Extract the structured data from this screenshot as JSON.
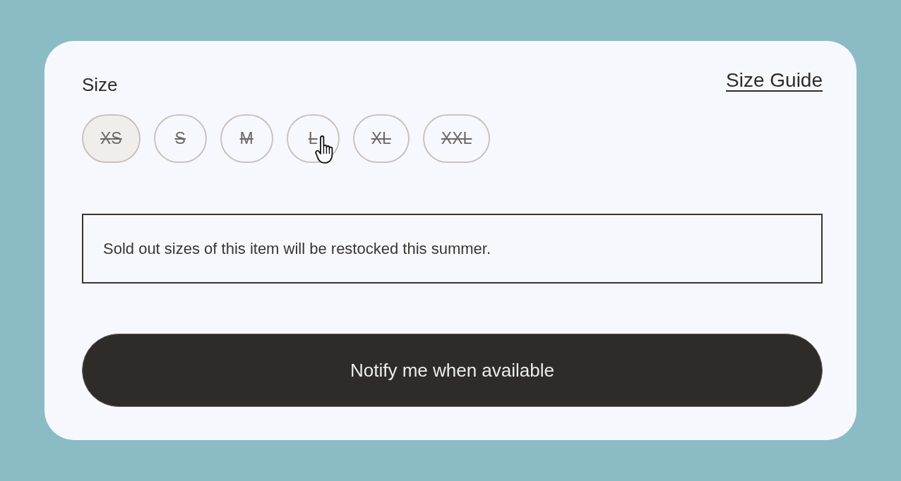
{
  "size_selector": {
    "label": "Size",
    "guide_link": "Size Guide",
    "options": [
      {
        "label": "XS",
        "selected": true,
        "sold_out": true,
        "hovered": false
      },
      {
        "label": "S",
        "selected": false,
        "sold_out": true,
        "hovered": false
      },
      {
        "label": "M",
        "selected": false,
        "sold_out": true,
        "hovered": false
      },
      {
        "label": "L",
        "selected": false,
        "sold_out": true,
        "hovered": true
      },
      {
        "label": "XL",
        "selected": false,
        "sold_out": true,
        "hovered": false
      },
      {
        "label": "XXL",
        "selected": false,
        "sold_out": true,
        "hovered": false
      }
    ]
  },
  "notice": {
    "text": "Sold out sizes of this item will be restocked this summer."
  },
  "notify_button": {
    "label": "Notify me when available"
  }
}
